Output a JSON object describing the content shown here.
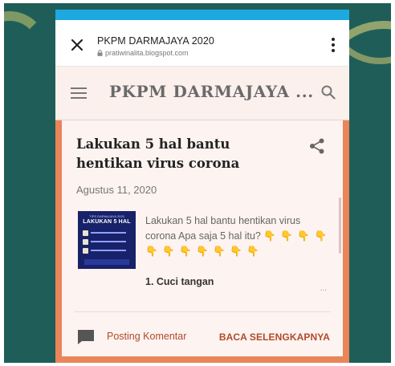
{
  "browser": {
    "page_title": "PKPM DARMAJAYA 2020",
    "url": "pratiwinalita.blogspot.com"
  },
  "blog": {
    "title": "PKPM DARMAJAYA ..."
  },
  "post": {
    "title": "Lakukan 5 hal bantu hentikan virus corona",
    "date": "Agustus 11, 2020",
    "excerpt": "Lakukan 5 hal bantu hentikan virus corona  Apa saja 5 hal itu?",
    "emoji_hands": "👇 👇 👇 👇 👇 👇 👇 👇 👇 👇 👇",
    "subheading": "1. Cuci tangan",
    "ellipsis": "...",
    "comment_label": "Posting Komentar",
    "read_more_label": "BACA SELENGKAPNYA",
    "thumbnail": {
      "header_text": "TIPS DARMAJAYA 2020",
      "title_text": "LAKUKAN 5 HAL"
    }
  },
  "colors": {
    "background": "#1f5e58",
    "frame": "#ea8459",
    "status_bar": "#1da9e0",
    "accent": "#b04a2a"
  }
}
